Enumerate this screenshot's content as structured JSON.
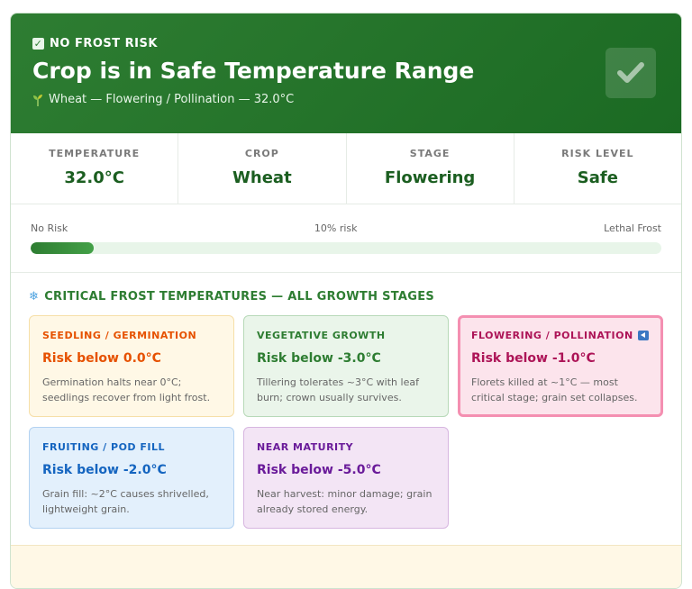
{
  "header": {
    "badge": "NO FROST RISK",
    "title": "Crop is in Safe Temperature Range",
    "subtitle": "Wheat — Flowering / Pollination — 32.0°C",
    "status_icon": "checkmark-icon"
  },
  "stats": [
    {
      "label": "TEMPERATURE",
      "value": "32.0°C"
    },
    {
      "label": "CROP",
      "value": "Wheat"
    },
    {
      "label": "STAGE",
      "value": "Flowering"
    },
    {
      "label": "RISK LEVEL",
      "value": "Safe"
    }
  ],
  "risk_meter": {
    "left_label": "No Risk",
    "center_label": "10% risk",
    "right_label": "Lethal Frost",
    "value_fraction": 0.1
  },
  "stages_section": {
    "title": "CRITICAL FROST TEMPERATURES — ALL GROWTH STAGES",
    "icon": "snowflake-icon",
    "cards": [
      {
        "name": "SEEDLING / GERMINATION",
        "risk": "Risk below 0.0°C",
        "desc": "Germination halts near 0°C; seedlings recover from light frost.",
        "accent": "#e65100",
        "bg": "#fff8e6",
        "border": "#f6dfa8",
        "current": false
      },
      {
        "name": "VEGETATIVE GROWTH",
        "risk": "Risk below -3.0°C",
        "desc": "Tillering tolerates ~3°C with leaf burn; crown usually survives.",
        "accent": "#2e7d32",
        "bg": "#eaf5ea",
        "border": "#b7d9b8",
        "current": false
      },
      {
        "name": "FLOWERING / POLLINATION",
        "risk": "Risk below -1.0°C",
        "desc": "Florets killed at ~1°C — most critical stage; grain set collapses.",
        "accent": "#ad1457",
        "bg": "#fce4ec",
        "border": "#f48fb1",
        "current": true
      },
      {
        "name": "FRUITING / POD FILL",
        "risk": "Risk below -2.0°C",
        "desc": "Grain fill: ~2°C causes shrivelled, lightweight grain.",
        "accent": "#1565c0",
        "bg": "#e3f0fc",
        "border": "#b3d2f1",
        "current": false
      },
      {
        "name": "NEAR MATURITY",
        "risk": "Risk below -5.0°C",
        "desc": "Near harvest: minor damage; grain already stored energy.",
        "accent": "#6a1b9a",
        "bg": "#f3e5f5",
        "border": "#d7b6e0",
        "current": false
      }
    ]
  }
}
